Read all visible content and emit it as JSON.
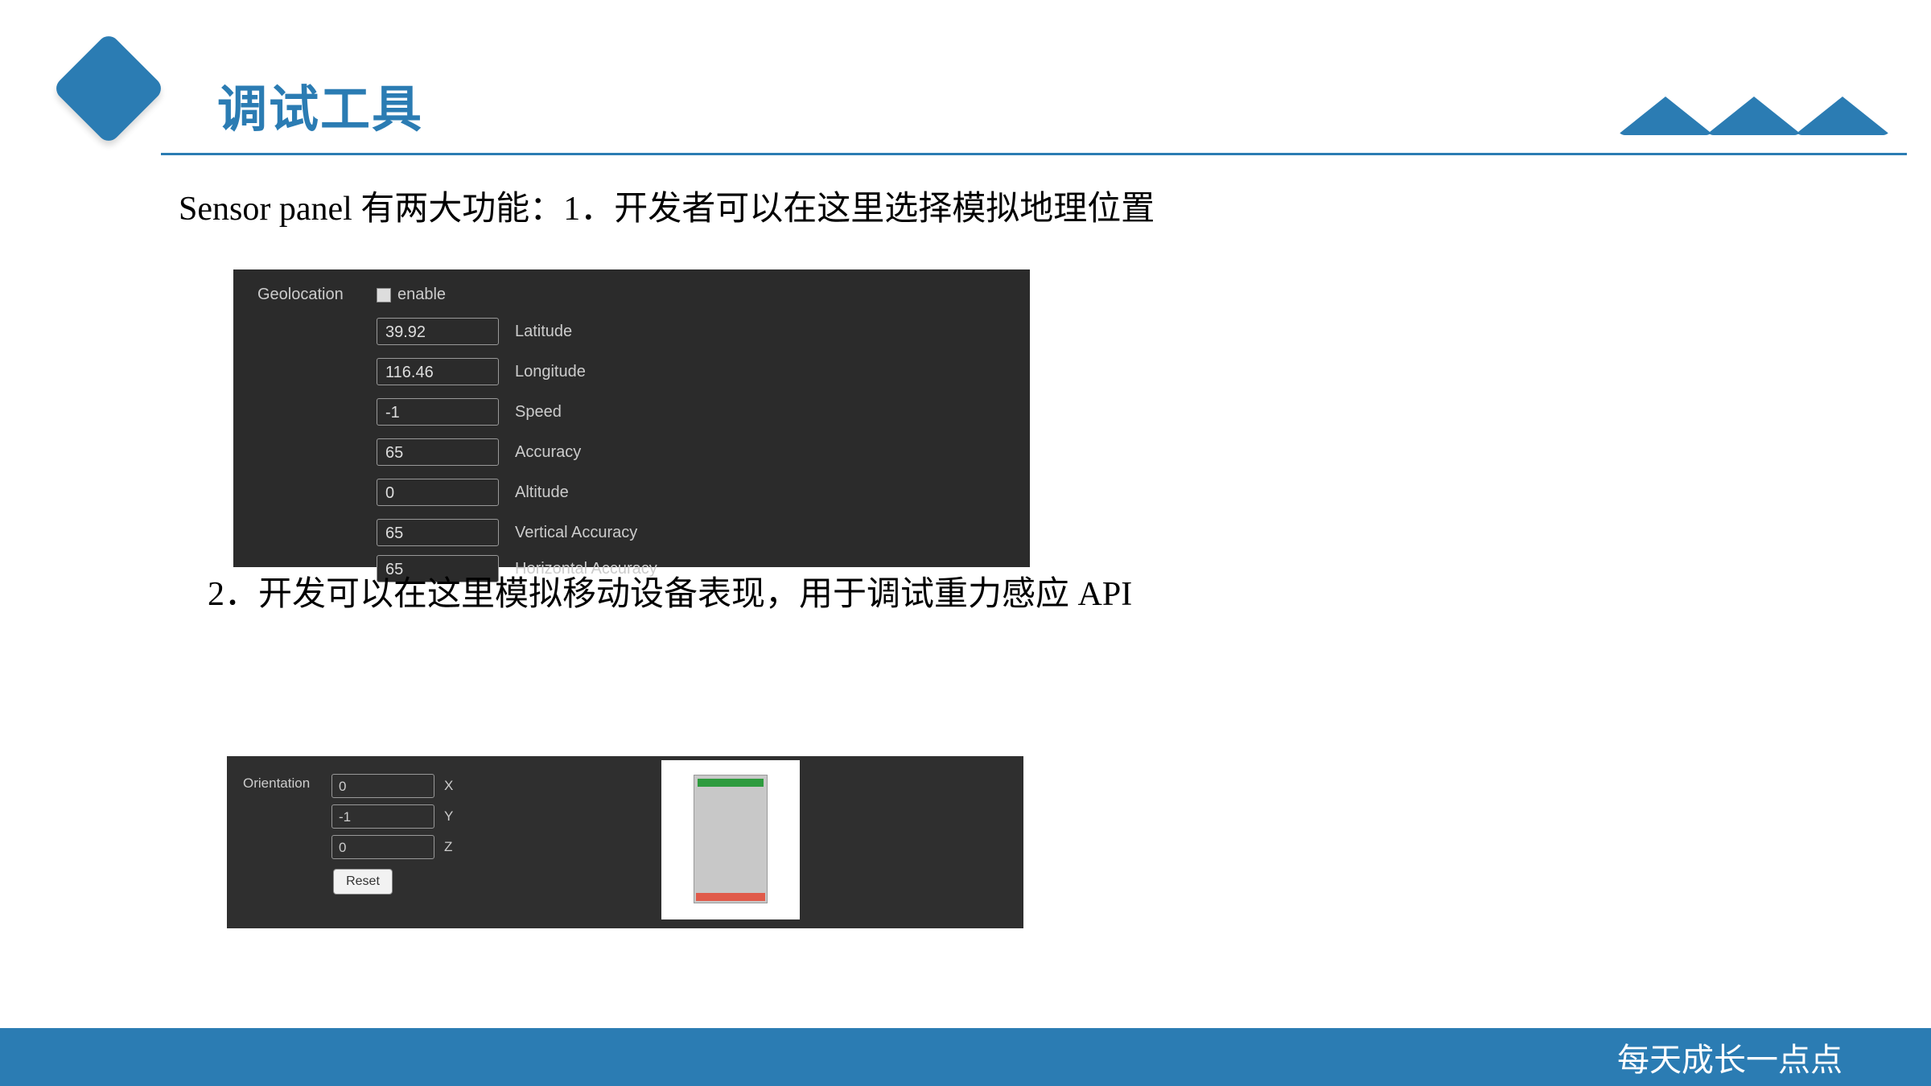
{
  "header": {
    "title": "调试工具"
  },
  "intro": {
    "line1": "Sensor panel 有两大功能：1．开发者可以在这里选择模拟地理位置",
    "line2": "2．开发可以在这里模拟移动设备表现，用于调试重力感应 API"
  },
  "geolocation": {
    "section_label": "Geolocation",
    "enable_label": "enable",
    "fields": {
      "latitude": {
        "label": "Latitude",
        "value": "39.92"
      },
      "longitude": {
        "label": "Longitude",
        "value": "116.46"
      },
      "speed": {
        "label": "Speed",
        "value": "-1"
      },
      "accuracy": {
        "label": "Accuracy",
        "value": "65"
      },
      "altitude": {
        "label": "Altitude",
        "value": "0"
      },
      "vacc": {
        "label": "Vertical Accuracy",
        "value": "65"
      },
      "hacc": {
        "label": "Horizontal Accuracy",
        "value": "65"
      }
    }
  },
  "orientation": {
    "section_label": "Orientation",
    "fields": {
      "x": {
        "label": "X",
        "value": "0"
      },
      "y": {
        "label": "Y",
        "value": "-1"
      },
      "z": {
        "label": "Z",
        "value": "0"
      }
    },
    "reset_label": "Reset"
  },
  "footer": {
    "text": "每天成长一点点"
  }
}
